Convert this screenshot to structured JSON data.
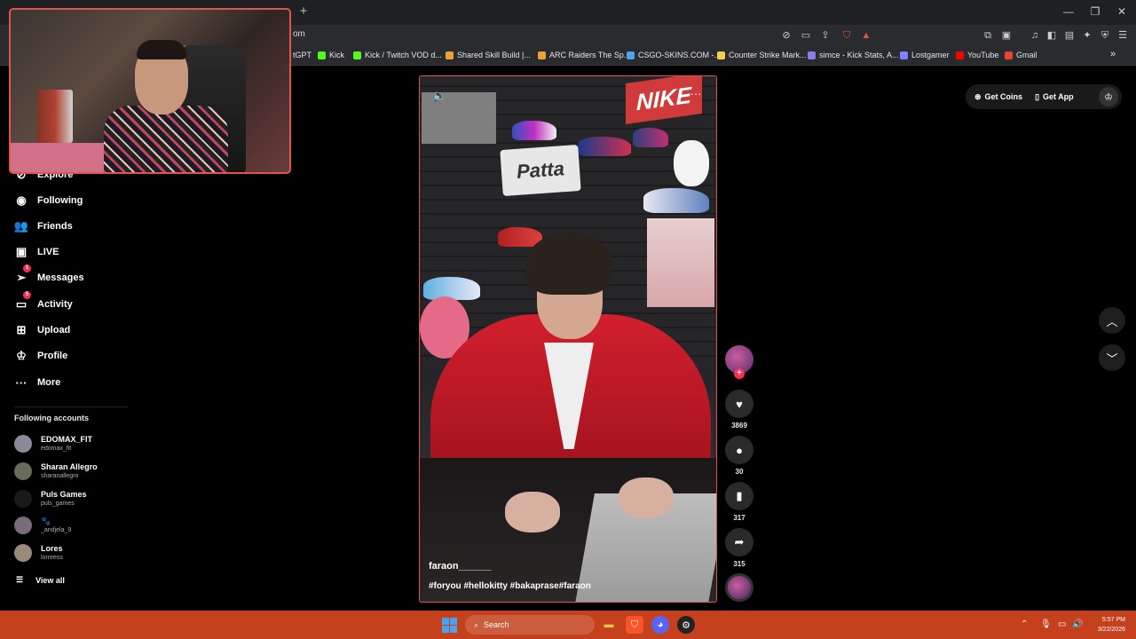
{
  "browser": {
    "url": "om",
    "new_tab": "+",
    "window_controls": [
      "—",
      "❐",
      "✕"
    ],
    "bookmarks": [
      {
        "label": "tGPT",
        "color": ""
      },
      {
        "label": "Kick",
        "color": "#53fc18"
      },
      {
        "label": "Kick / Twitch VOD d...",
        "color": "#53fc18"
      },
      {
        "label": "Shared Skill Build |...",
        "color": "#e8a03a"
      },
      {
        "label": "ARC Raiders The Sp...",
        "color": "#e8a03a"
      },
      {
        "label": "CSGO-SKINS.COM -...",
        "color": "#4aa3f0"
      },
      {
        "label": "Counter Strike Mark...",
        "color": "#f0d04a"
      },
      {
        "label": "simce - Kick Stats, A...",
        "color": "#8a7cf0"
      },
      {
        "label": "Lostgamer",
        "color": "#7f7fff"
      },
      {
        "label": "YouTube",
        "color": "#ff0000"
      },
      {
        "label": "Gmail",
        "color": "#ea4335"
      }
    ],
    "bookmarks_more": "»"
  },
  "sidebar": {
    "items": [
      {
        "label": "Explore",
        "icon": "⊘"
      },
      {
        "label": "Following",
        "icon": "◉"
      },
      {
        "label": "Friends",
        "icon": "👥"
      },
      {
        "label": "LIVE",
        "icon": "▣"
      },
      {
        "label": "Messages",
        "icon": "➢",
        "badge": "1"
      },
      {
        "label": "Activity",
        "icon": "▭",
        "badge": "5"
      },
      {
        "label": "Upload",
        "icon": "⊞"
      },
      {
        "label": "Profile",
        "icon": "♔"
      },
      {
        "label": "More",
        "icon": "···"
      }
    ],
    "following_title": "Following accounts",
    "accounts": [
      {
        "name": "EDOMAX_FIT",
        "user": "edomax_fit",
        "color": "#8a8a9a"
      },
      {
        "name": "Sharan Allegro",
        "user": "sharanallegro",
        "color": "#6a6a5a"
      },
      {
        "name": "Puls Games",
        "user": "puls_games",
        "color": "#1a1a1a"
      },
      {
        "name": "🐾",
        "user": "_andjela_9",
        "color": "#7a6a7a"
      },
      {
        "name": "Lores",
        "user": "lorreess",
        "color": "#9a8a7a"
      }
    ],
    "view_all": "View all"
  },
  "video": {
    "author": "faraon______",
    "hashtags": "#foryou #hellokitty #bakaprase#faraon",
    "brand_text": "NIKE",
    "patta_text": "Patta",
    "likes": "3869",
    "comments": "30",
    "saves": "317",
    "shares": "315"
  },
  "topright": {
    "coins": "Get Coins",
    "app": "Get App"
  },
  "taskbar": {
    "search": "Search",
    "time": "5:57 PM",
    "date": "3/22/2026"
  }
}
